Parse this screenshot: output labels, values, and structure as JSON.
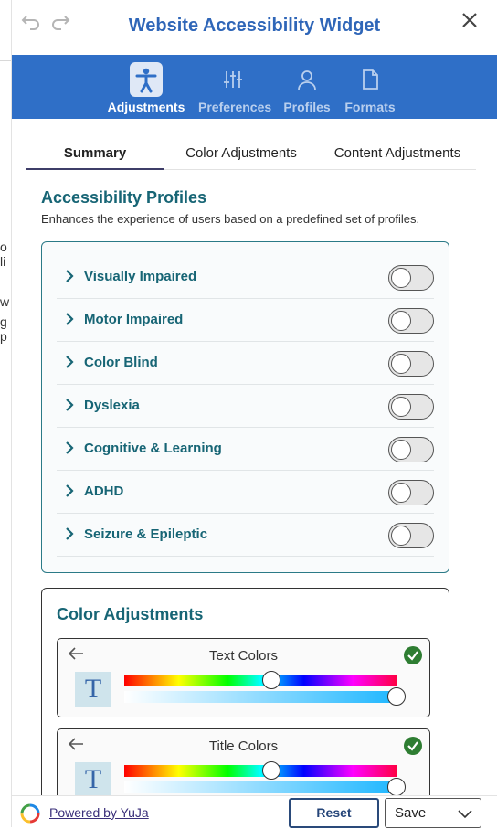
{
  "background_page": {
    "fragments": [
      "o li",
      "w",
      "g p"
    ]
  },
  "header": {
    "title": "Website Accessibility Widget",
    "undo_icon": "undo-icon",
    "redo_icon": "redo-icon",
    "close_icon": "close-icon"
  },
  "nav": {
    "items": [
      {
        "label": "Adjustments",
        "icon": "accessibility-person-icon",
        "active": true
      },
      {
        "label": "Preferences",
        "icon": "sliders-icon",
        "active": false
      },
      {
        "label": "Profiles",
        "icon": "user-icon",
        "active": false
      },
      {
        "label": "Formats",
        "icon": "document-icon",
        "active": false
      }
    ]
  },
  "tabs": [
    {
      "label": "Summary",
      "active": true
    },
    {
      "label": "Color Adjustments",
      "active": false
    },
    {
      "label": "Content Adjustments",
      "active": false
    }
  ],
  "profiles_section": {
    "title": "Accessibility Profiles",
    "description": "Enhances the experience of users based on a predefined set of profiles.",
    "items": [
      {
        "label": "Visually Impaired",
        "enabled": false
      },
      {
        "label": "Motor Impaired",
        "enabled": false
      },
      {
        "label": "Color Blind",
        "enabled": false
      },
      {
        "label": "Dyslexia",
        "enabled": false
      },
      {
        "label": "Cognitive & Learning",
        "enabled": false
      },
      {
        "label": "ADHD",
        "enabled": false
      },
      {
        "label": "Seizure & Epileptic",
        "enabled": false
      }
    ]
  },
  "color_section": {
    "title": "Color Adjustments",
    "cards": [
      {
        "label": "Text Colors",
        "icon_letter": "T",
        "hue_level": 0.54,
        "saturation_level": 1.0
      },
      {
        "label": "Title Colors",
        "icon_letter": "T",
        "hue_level": 0.54,
        "saturation_level": 1.0
      }
    ]
  },
  "footer": {
    "powered_by": "Powered by YuJa",
    "reset_label": "Reset",
    "save_label": "Save"
  },
  "colors": {
    "accent_blue": "#2f6fc7",
    "teal": "#176575",
    "title_blue": "#2f66b8"
  }
}
